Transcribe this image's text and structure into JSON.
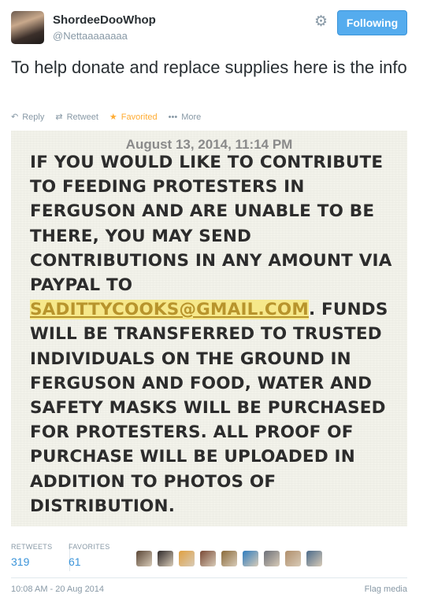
{
  "user": {
    "name": "ShordeeDooWhop",
    "handle": "@Nettaaaaaaaa"
  },
  "follow_button": {
    "label": "Following"
  },
  "tweet": {
    "text": "To help donate and replace supplies here is the info"
  },
  "actions": {
    "reply": "Reply",
    "retweet": "Retweet",
    "favorited": "Favorited",
    "more": "More"
  },
  "media": {
    "date": "August 13, 2014, 11:14 PM",
    "text_before": "IF YOU WOULD LIKE TO CONTRIBUTE TO FEEDING PROTESTERS IN FERGUSON AND ARE UNABLE TO BE THERE, YOU MAY SEND CONTRIBUTIONS IN ANY AMOUNT VIA PAYPAL TO ",
    "email": "SADITTYCOOKS@GMAIL.COM",
    "text_after": ". FUNDS WILL BE TRANSFERRED TO TRUSTED INDIVIDUALS ON THE GROUND IN FERGUSON AND FOOD, WATER AND SAFETY MASKS WILL BE PURCHASED FOR PROTESTERS. ALL PROOF OF PURCHASE WILL BE UPLOADED IN ADDITION TO PHOTOS OF DISTRIBUTION."
  },
  "stats": {
    "retweets_label": "RETWEETS",
    "retweets_value": "319",
    "favorites_label": "FAVORITES",
    "favorites_value": "61"
  },
  "favoriter_avatars": [
    "#5a4636",
    "#2f2a2a",
    "#e0a040",
    "#7a4a36",
    "#8a6a3a",
    "#2e7dbf",
    "#6b6f78",
    "#b08e6a",
    "#4a6a8a"
  ],
  "timestamp": "10:08 AM - 20 Aug 2014",
  "flag_media": "Flag media",
  "colors": {
    "accent": "#55acee",
    "link": "#3b94d9",
    "favorite": "#ffac33",
    "muted": "#8899a6"
  }
}
